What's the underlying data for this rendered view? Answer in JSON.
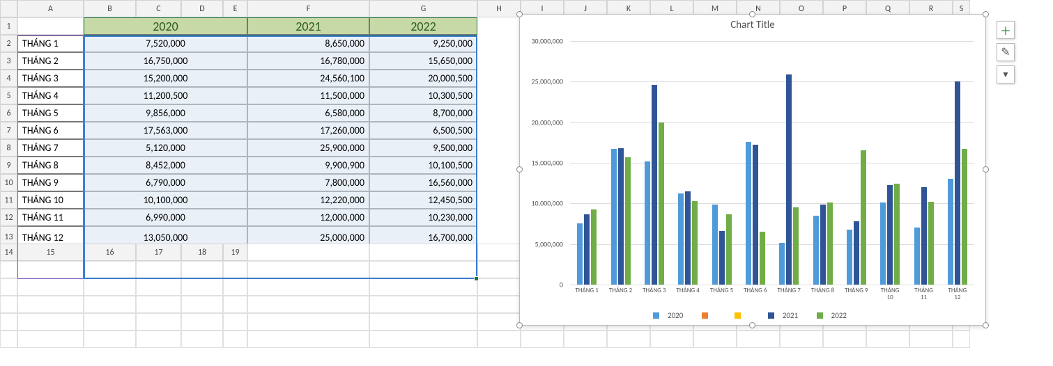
{
  "columns": [
    "A",
    "B",
    "C",
    "D",
    "E",
    "F",
    "G",
    "H",
    "I",
    "J",
    "K",
    "L",
    "M",
    "N",
    "O",
    "P",
    "Q",
    "R",
    "S"
  ],
  "row_numbers": [
    1,
    2,
    3,
    4,
    5,
    6,
    7,
    8,
    9,
    10,
    11,
    12,
    13,
    14,
    15,
    16,
    17,
    18,
    19
  ],
  "header": {
    "y2020": "2020",
    "y2021": "2021",
    "y2022": "2022"
  },
  "months": [
    "THÁNG 1",
    "THÁNG 2",
    "THÁNG 3",
    "THÁNG 4",
    "THÁNG 5",
    "THÁNG 6",
    "THÁNG 7",
    "THÁNG 8",
    "THÁNG 9",
    "THÁNG 10",
    "THÁNG 11",
    "THÁNG 12"
  ],
  "table_display": {
    "y2020": [
      "7,520,000",
      "16,750,000",
      "15,200,000",
      "11,200,500",
      "9,856,000",
      "17,563,000",
      "5,120,000",
      "8,452,000",
      "6,790,000",
      "10,100,000",
      "6,990,000",
      "13,050,000"
    ],
    "y2021": [
      "8,650,000",
      "16,780,000",
      "24,560,100",
      "11,500,000",
      "6,580,000",
      "17,260,000",
      "25,900,000",
      "9,900,900",
      "7,800,000",
      "12,220,000",
      "12,000,000",
      "25,000,000"
    ],
    "y2022": [
      "9,250,000",
      "15,650,000",
      "20,000,500",
      "10,300,500",
      "8,700,000",
      "6,500,500",
      "9,500,000",
      "10,100,500",
      "16,560,000",
      "12,450,500",
      "10,230,000",
      "16,700,000"
    ]
  },
  "chart_title": "Chart Title",
  "legend": {
    "s1": "2020",
    "s2": "",
    "s3": "",
    "s4": "2021",
    "s5": "2022"
  },
  "y_ticks": [
    "0",
    "5,000,000",
    "10,000,000",
    "15,000,000",
    "20,000,000",
    "25,000,000",
    "30,000,000"
  ],
  "chart_data": {
    "type": "bar",
    "title": "Chart Title",
    "categories": [
      "THÁNG 1",
      "THÁNG 2",
      "THÁNG 3",
      "THÁNG 4",
      "THÁNG 5",
      "THÁNG 6",
      "THÁNG 7",
      "THÁNG 8",
      "THÁNG 9",
      "THÁNG 10",
      "THÁNG 11",
      "THÁNG 12"
    ],
    "series": [
      {
        "name": "2020",
        "color": "#4f9bd9",
        "values": [
          7520000,
          16750000,
          15200000,
          11200500,
          9856000,
          17563000,
          5120000,
          8452000,
          6790000,
          10100000,
          6990000,
          13050000
        ]
      },
      {
        "name": "2021",
        "color": "#2f5597",
        "values": [
          8650000,
          16780000,
          24560100,
          11500000,
          6580000,
          17260000,
          25900000,
          9900900,
          7800000,
          12220000,
          12000000,
          25000000
        ]
      },
      {
        "name": "2022",
        "color": "#70ad47",
        "values": [
          9250000,
          15650000,
          20000500,
          10300500,
          8700000,
          6500500,
          9500000,
          10100500,
          16560000,
          12450500,
          10230000,
          16700000
        ]
      }
    ],
    "legend_extra_colors": [
      "#ed7d31",
      "#ffc000"
    ],
    "ylim": [
      0,
      30000000
    ],
    "xlabel": "",
    "ylabel": ""
  },
  "colors": {
    "s2020": "#4f9bd9",
    "s_extra1": "#ed7d31",
    "s_extra2": "#ffc000",
    "s2021": "#2f5597",
    "s2022": "#70ad47"
  },
  "side_icons": {
    "plus": "＋",
    "brush": "✎",
    "filter": "▼"
  }
}
